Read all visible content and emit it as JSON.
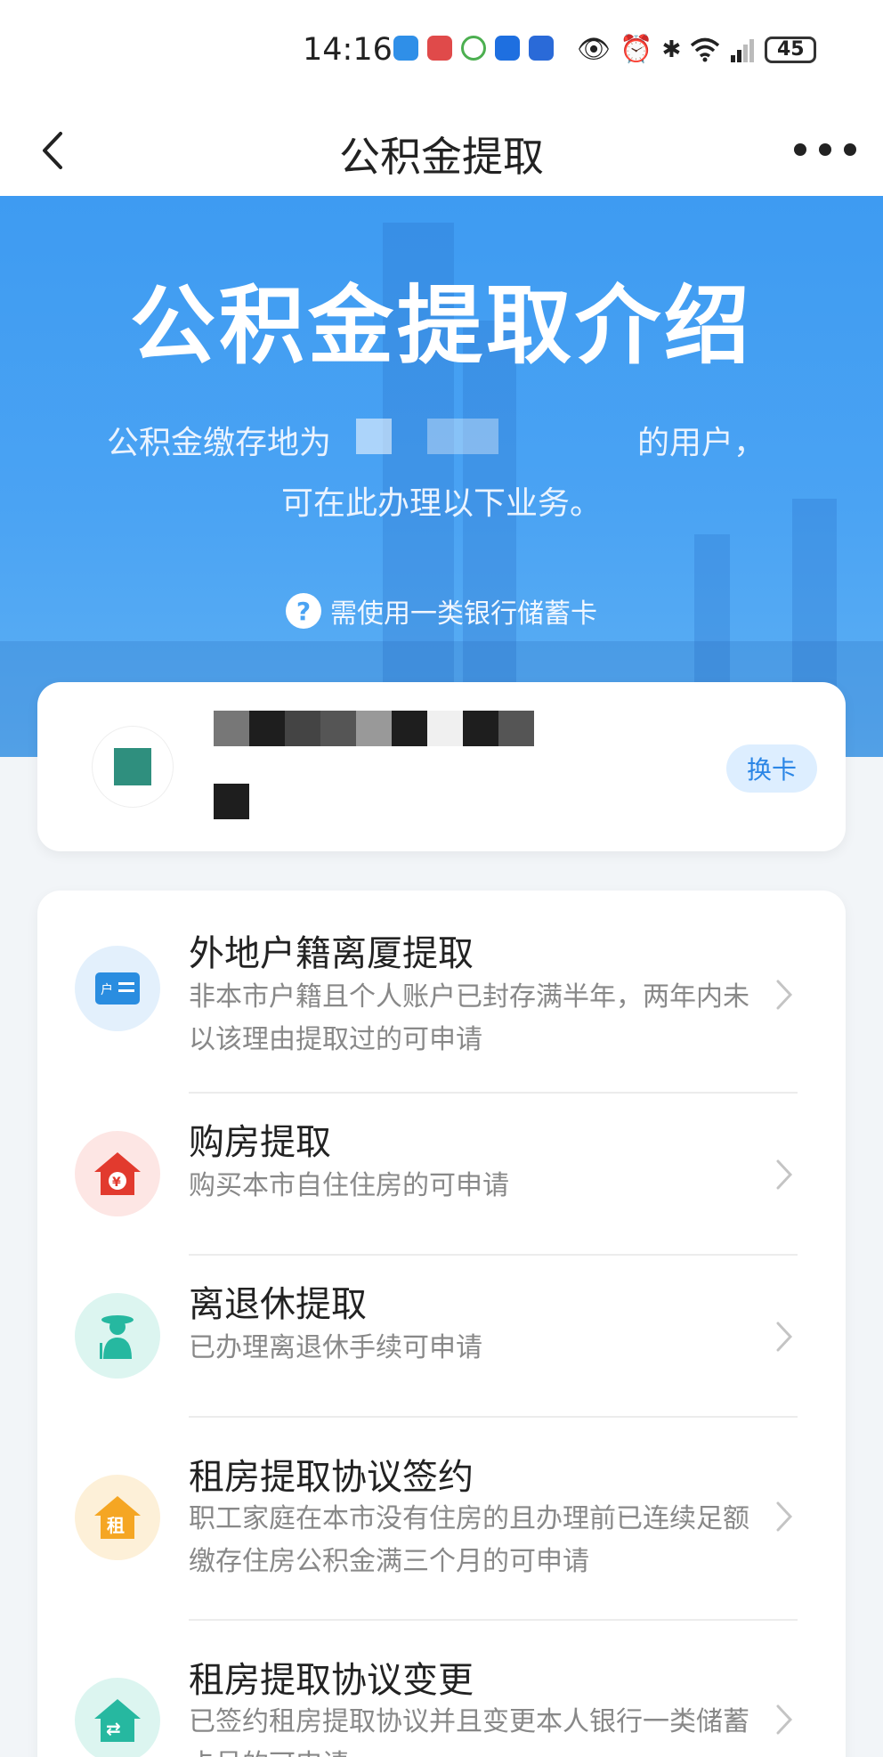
{
  "status_bar": {
    "time": "14:16",
    "battery": "45"
  },
  "header": {
    "title": "公积金提取"
  },
  "banner": {
    "title": "公积金提取介绍",
    "line1_start": "公积金缴存地为",
    "line1_end": "的用户，",
    "line2": "可在此办理以下业务。",
    "hint": "需使用一类银行储蓄卡"
  },
  "card": {
    "switch_label": "换卡"
  },
  "services": [
    {
      "title": "外地户籍离厦提取",
      "desc": "非本市户籍且个人账户已封存满半年，两年内未以该理由提取过的可申请",
      "icon": "id-card-icon",
      "color": "#2a8de0"
    },
    {
      "title": "购房提取",
      "desc": "购买本市自住住房的可申请",
      "icon": "house-yuan-icon",
      "color": "#e23a2e"
    },
    {
      "title": "离退休提取",
      "desc": "已办理离退休手续可申请",
      "icon": "elderly-person-icon",
      "color": "#26b8a0"
    },
    {
      "title": "租房提取协议签约",
      "desc": "职工家庭在本市没有住房的且办理前已连续足额缴存住房公积金满三个月的可申请",
      "icon": "house-rent-icon",
      "color": "#f5a623"
    },
    {
      "title": "租房提取协议变更",
      "desc": "已签约租房提取协议并且变更本人银行一类储蓄卡号的可申请",
      "icon": "house-change-icon",
      "color": "#26b8a0"
    }
  ]
}
